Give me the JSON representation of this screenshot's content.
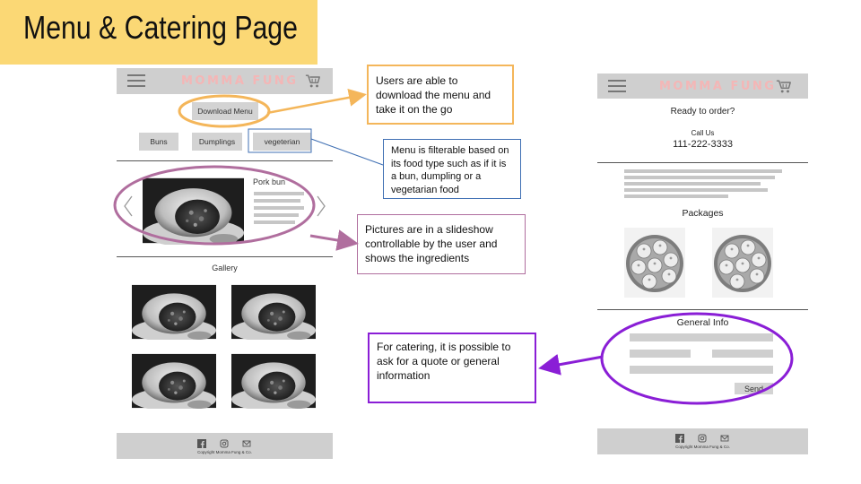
{
  "slide": {
    "title": "Menu & Catering Page"
  },
  "menu_phone": {
    "logo": "MOMMA FUNG",
    "download_button": "Download Menu",
    "filters": [
      "Buns",
      "Dumplings",
      "vegeterian"
    ],
    "slide_item_title": "Pork bun",
    "gallery_title": "Gallery",
    "copyright": "Copyright Momma Fung & Co."
  },
  "catering_phone": {
    "logo": "MOMMA FUNG",
    "ready_text": "Ready to order?",
    "call_label": "Call Us",
    "phone_number": "111-222-3333",
    "packages_title": "Packages",
    "general_info_title": "General Info",
    "send_button": "Send",
    "copyright": "Copyright Momma Fung & Co."
  },
  "annotations": {
    "download": "Users are able to download the menu and take it on the go",
    "filter": "Menu is filterable based on its food type such as if it is a bun, dumpling or a vegetarian food",
    "slideshow": "Pictures are in a slideshow controllable by the user and shows the ingredients",
    "catering": "For catering, it is possible to ask for a quote or general information"
  },
  "colors": {
    "title_bg": "#fbd875",
    "download_annotation": "#f4b65a",
    "filter_annotation": "#3f6fb3",
    "slideshow_annotation": "#b06e9e",
    "catering_annotation": "#8a1ed6"
  }
}
